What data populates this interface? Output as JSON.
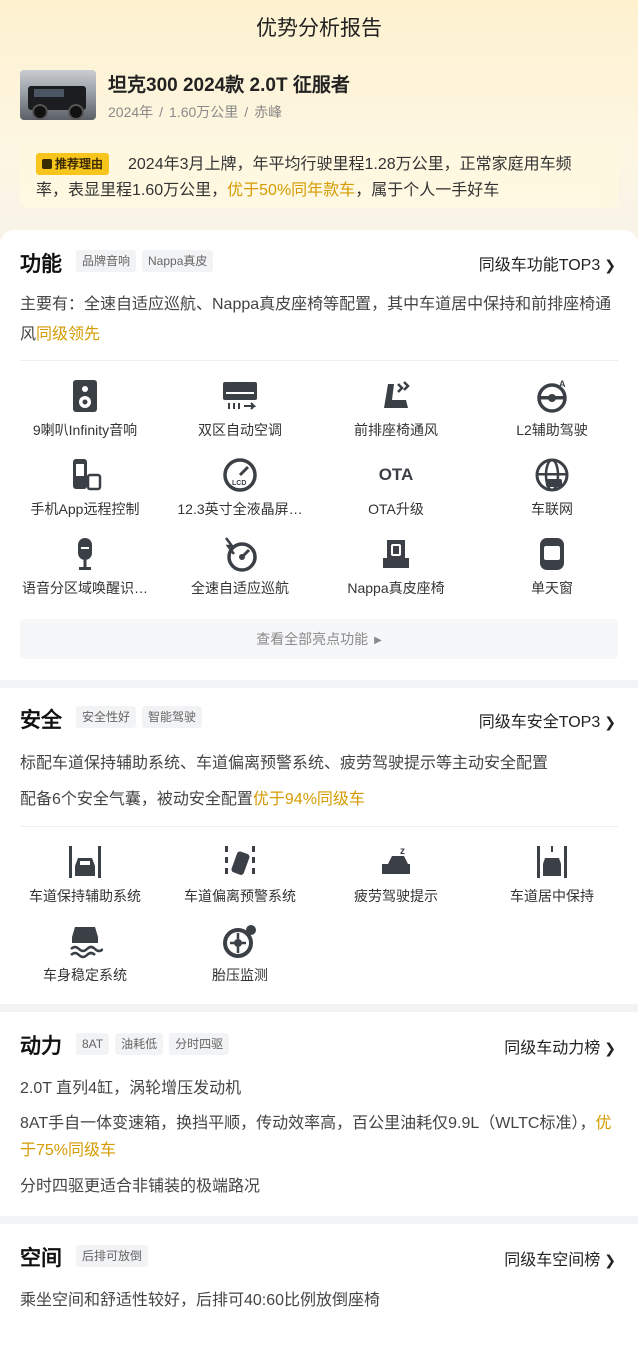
{
  "header": {
    "title": "优势分析报告"
  },
  "car": {
    "name": "坦克300 2024款 2.0T 征服者",
    "year": "2024年",
    "mileage": "1.60万公里",
    "city": "赤峰",
    "sep": "/"
  },
  "reason": {
    "tag": "推荐理由",
    "text_a": "2024年3月上牌，年平均行驶里程1.28万公里，正常家庭用车频率，表显里程1.60万公里，",
    "text_hl": "优于50%同年款车",
    "text_b": "，属于个人一手好车"
  },
  "function": {
    "title": "功能",
    "chips": [
      "品牌音响",
      "Nappa真皮"
    ],
    "rank": "同级车功能TOP3",
    "desc_a": "主要有：全速自适应巡航、Nappa真皮座椅等配置，其中车道居中保持和前排座椅通风",
    "desc_hl": "同级领先",
    "features": [
      {
        "label": "9喇叭Infinity音响",
        "icon": "speaker-icon"
      },
      {
        "label": "双区自动空调",
        "icon": "air-conditioner-icon"
      },
      {
        "label": "前排座椅通风",
        "icon": "seat-ventilation-icon"
      },
      {
        "label": "L2辅助驾驶",
        "icon": "steering-wheel-icon"
      },
      {
        "label": "手机App远程控制",
        "icon": "phone-remote-icon"
      },
      {
        "label": "12.3英寸全液晶屏…",
        "icon": "lcd-gauge-icon"
      },
      {
        "label": "OTA升级",
        "icon": "ota-icon"
      },
      {
        "label": "车联网",
        "icon": "globe-car-icon"
      },
      {
        "label": "语音分区域唤醒识…",
        "icon": "microphone-icon"
      },
      {
        "label": "全速自适应巡航",
        "icon": "cruise-gauge-icon"
      },
      {
        "label": "Nappa真皮座椅",
        "icon": "leather-seat-icon"
      },
      {
        "label": "单天窗",
        "icon": "sunroof-icon"
      }
    ],
    "ota_text": "OTA",
    "lcd_text": "LCD",
    "more": "查看全部亮点功能"
  },
  "safety": {
    "title": "安全",
    "chips": [
      "安全性好",
      "智能驾驶"
    ],
    "rank": "同级车安全TOP3",
    "line1": "标配车道保持辅助系统、车道偏离预警系统、疲劳驾驶提示等主动安全配置",
    "line2_a": "配备6个安全气囊，被动安全配置",
    "line2_hl": "优于94%同级车",
    "features": [
      {
        "label": "车道保持辅助系统",
        "icon": "lane-keep-icon"
      },
      {
        "label": "车道偏离预警系统",
        "icon": "lane-departure-icon"
      },
      {
        "label": "疲劳驾驶提示",
        "icon": "fatigue-alert-icon"
      },
      {
        "label": "车道居中保持",
        "icon": "lane-center-icon"
      },
      {
        "label": "车身稳定系统",
        "icon": "stability-icon"
      },
      {
        "label": "胎压监测",
        "icon": "tire-pressure-icon"
      }
    ]
  },
  "power": {
    "title": "动力",
    "chips": [
      "8AT",
      "油耗低",
      "分时四驱"
    ],
    "rank": "同级车动力榜",
    "line1": "2.0T 直列4缸，涡轮增压发动机",
    "line2_a": "8AT手自一体变速箱，换挡平顺，传动效率高，百公里油耗仅9.9L（WLTC标准），",
    "line2_hl": "优于75%同级车",
    "line3": "分时四驱更适合非铺装的极端路况"
  },
  "space": {
    "title": "空间",
    "chips": [
      "后排可放倒"
    ],
    "rank": "同级车空间榜",
    "line1": "乘坐空间和舒适性较好，后排可40:60比例放倒座椅"
  },
  "colors": {
    "accent": "#d59b00",
    "tag": "#f8c51c",
    "icon": "#3b3f46"
  }
}
